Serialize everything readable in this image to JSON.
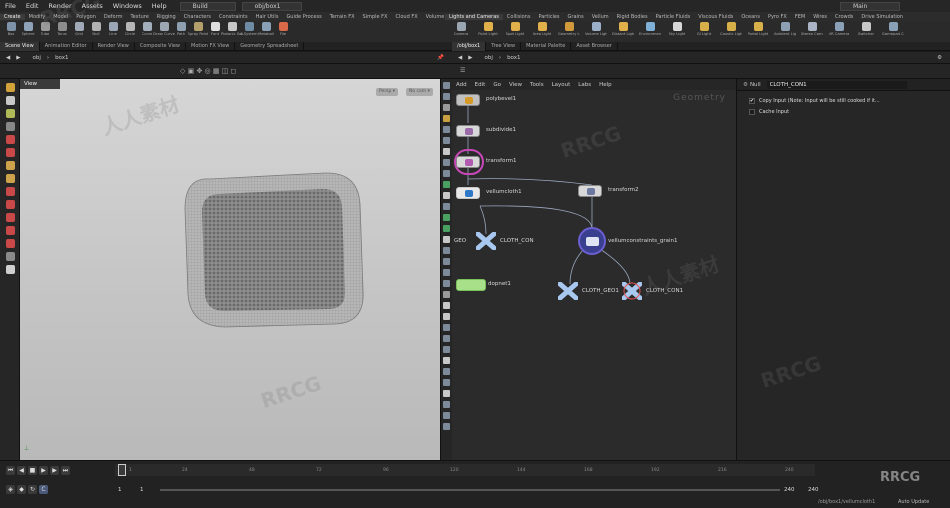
{
  "menubar": {
    "items": [
      "File",
      "Edit",
      "Render",
      "Assets",
      "Windows",
      "Help"
    ],
    "desktop": "Build",
    "scene": "obj/box1",
    "main": "Main"
  },
  "shelf_tabs_left": [
    "Create",
    "Modify",
    "Model",
    "Polygon",
    "Deform",
    "Texture",
    "Rigging",
    "Characters",
    "Constraints",
    "Hair Utils",
    "Guide Process",
    "Terrain FX",
    "Simple FX",
    "Cloud FX",
    "Volume",
    "KFX"
  ],
  "shelf_tabs_right": [
    "Lights and Cameras",
    "Collisions",
    "Particles",
    "Grains",
    "Vellum",
    "Rigid Bodies",
    "Particle Fluids",
    "Viscous Fluids",
    "Oceans",
    "Pyro FX",
    "FEM",
    "Wires",
    "Crowds",
    "Drive Simulation"
  ],
  "tools_left": [
    "Box",
    "Sphere",
    "Tube",
    "Torus",
    "Grid",
    "Null",
    "Line",
    "Circle",
    "Curve",
    "Draw Curve",
    "Path",
    "Spray Paint",
    "Font",
    "Platonic Solids",
    "L-System",
    "Metaball",
    "File"
  ],
  "tools_right": [
    "Camera",
    "Point Light",
    "Spot Light",
    "Area Light",
    "Geometry Light",
    "Volume Light",
    "Distant Light",
    "Environment Light",
    "Sky Light",
    "GI Light",
    "Caustic Light",
    "Portal Light",
    "Ambient Light",
    "Stereo Camera",
    "VR Camera",
    "Switcher",
    "Gamepad Camera"
  ],
  "left_pane_tabs": [
    "Scene View",
    "Animation Editor",
    "Render View",
    "Composite View",
    "Motion FX View",
    "Geometry Spreadsheet"
  ],
  "right_pane_tabs": [
    "/obj/box1",
    "Tree View",
    "Material Palette",
    "Asset Browser"
  ],
  "path": {
    "left": "obj",
    "left_node": "box1",
    "right": "obj",
    "right_node": "box1"
  },
  "viewport": {
    "title": "View",
    "persp": "Persp ▾",
    "cam": "No cam ▾"
  },
  "network_menu": [
    "Add",
    "Edit",
    "Go",
    "View",
    "Tools",
    "Layout",
    "Labs",
    "Help"
  ],
  "network_type": "Geometry",
  "nodes": {
    "polybevel": "polybevel1",
    "subdivide": "subdivide1",
    "transform1": "transform1",
    "vellumcloth": "vellumcloth1",
    "transform2": "transform2",
    "geo": "GEO",
    "cloth_con": "CLOTH_CON",
    "vellumconstraints": "vellumconstraints_grain1",
    "dopnet": "dopnet1",
    "cloth_geo": "CLOTH_GEO1",
    "cloth_con1": "CLOTH_CON1"
  },
  "params": {
    "type": "Null",
    "name": "CLOTH_CON1",
    "copy_input": "Copy Input (Note: Input will be still cooked if it...",
    "cache_input": "Cache Input"
  },
  "timeline": {
    "ticks": [
      "1",
      "24",
      "48",
      "72",
      "96",
      "120",
      "144",
      "168",
      "192",
      "216",
      "240"
    ],
    "frame": "1",
    "start": "1",
    "end": "240",
    "end2": "240",
    "auto_update": "Auto Update",
    "status": "/obj/box1/vellumcloth1"
  },
  "watermarks": [
    "RRCG",
    "人人素材"
  ]
}
